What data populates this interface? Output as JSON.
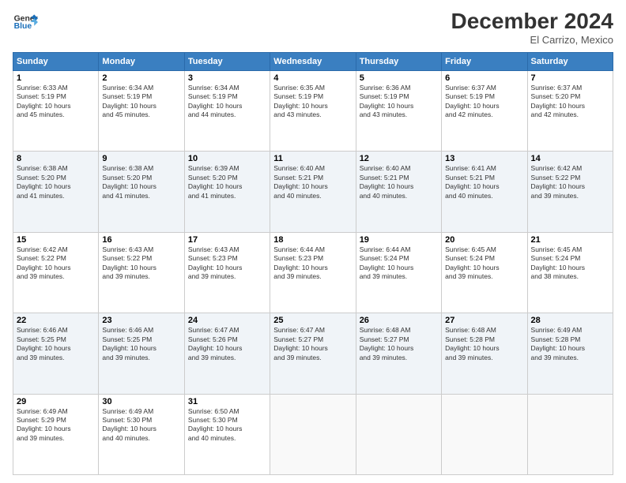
{
  "header": {
    "title": "December 2024",
    "subtitle": "El Carrizo, Mexico"
  },
  "calendar": {
    "days": [
      "Sunday",
      "Monday",
      "Tuesday",
      "Wednesday",
      "Thursday",
      "Friday",
      "Saturday"
    ],
    "weeks": [
      [
        {
          "day": "1",
          "info": "Sunrise: 6:33 AM\nSunset: 5:19 PM\nDaylight: 10 hours\nand 45 minutes."
        },
        {
          "day": "2",
          "info": "Sunrise: 6:34 AM\nSunset: 5:19 PM\nDaylight: 10 hours\nand 45 minutes."
        },
        {
          "day": "3",
          "info": "Sunrise: 6:34 AM\nSunset: 5:19 PM\nDaylight: 10 hours\nand 44 minutes."
        },
        {
          "day": "4",
          "info": "Sunrise: 6:35 AM\nSunset: 5:19 PM\nDaylight: 10 hours\nand 43 minutes."
        },
        {
          "day": "5",
          "info": "Sunrise: 6:36 AM\nSunset: 5:19 PM\nDaylight: 10 hours\nand 43 minutes."
        },
        {
          "day": "6",
          "info": "Sunrise: 6:37 AM\nSunset: 5:19 PM\nDaylight: 10 hours\nand 42 minutes."
        },
        {
          "day": "7",
          "info": "Sunrise: 6:37 AM\nSunset: 5:20 PM\nDaylight: 10 hours\nand 42 minutes."
        }
      ],
      [
        {
          "day": "8",
          "info": "Sunrise: 6:38 AM\nSunset: 5:20 PM\nDaylight: 10 hours\nand 41 minutes."
        },
        {
          "day": "9",
          "info": "Sunrise: 6:38 AM\nSunset: 5:20 PM\nDaylight: 10 hours\nand 41 minutes."
        },
        {
          "day": "10",
          "info": "Sunrise: 6:39 AM\nSunset: 5:20 PM\nDaylight: 10 hours\nand 41 minutes."
        },
        {
          "day": "11",
          "info": "Sunrise: 6:40 AM\nSunset: 5:21 PM\nDaylight: 10 hours\nand 40 minutes."
        },
        {
          "day": "12",
          "info": "Sunrise: 6:40 AM\nSunset: 5:21 PM\nDaylight: 10 hours\nand 40 minutes."
        },
        {
          "day": "13",
          "info": "Sunrise: 6:41 AM\nSunset: 5:21 PM\nDaylight: 10 hours\nand 40 minutes."
        },
        {
          "day": "14",
          "info": "Sunrise: 6:42 AM\nSunset: 5:22 PM\nDaylight: 10 hours\nand 39 minutes."
        }
      ],
      [
        {
          "day": "15",
          "info": "Sunrise: 6:42 AM\nSunset: 5:22 PM\nDaylight: 10 hours\nand 39 minutes."
        },
        {
          "day": "16",
          "info": "Sunrise: 6:43 AM\nSunset: 5:22 PM\nDaylight: 10 hours\nand 39 minutes."
        },
        {
          "day": "17",
          "info": "Sunrise: 6:43 AM\nSunset: 5:23 PM\nDaylight: 10 hours\nand 39 minutes."
        },
        {
          "day": "18",
          "info": "Sunrise: 6:44 AM\nSunset: 5:23 PM\nDaylight: 10 hours\nand 39 minutes."
        },
        {
          "day": "19",
          "info": "Sunrise: 6:44 AM\nSunset: 5:24 PM\nDaylight: 10 hours\nand 39 minutes."
        },
        {
          "day": "20",
          "info": "Sunrise: 6:45 AM\nSunset: 5:24 PM\nDaylight: 10 hours\nand 39 minutes."
        },
        {
          "day": "21",
          "info": "Sunrise: 6:45 AM\nSunset: 5:24 PM\nDaylight: 10 hours\nand 38 minutes."
        }
      ],
      [
        {
          "day": "22",
          "info": "Sunrise: 6:46 AM\nSunset: 5:25 PM\nDaylight: 10 hours\nand 39 minutes."
        },
        {
          "day": "23",
          "info": "Sunrise: 6:46 AM\nSunset: 5:25 PM\nDaylight: 10 hours\nand 39 minutes."
        },
        {
          "day": "24",
          "info": "Sunrise: 6:47 AM\nSunset: 5:26 PM\nDaylight: 10 hours\nand 39 minutes."
        },
        {
          "day": "25",
          "info": "Sunrise: 6:47 AM\nSunset: 5:27 PM\nDaylight: 10 hours\nand 39 minutes."
        },
        {
          "day": "26",
          "info": "Sunrise: 6:48 AM\nSunset: 5:27 PM\nDaylight: 10 hours\nand 39 minutes."
        },
        {
          "day": "27",
          "info": "Sunrise: 6:48 AM\nSunset: 5:28 PM\nDaylight: 10 hours\nand 39 minutes."
        },
        {
          "day": "28",
          "info": "Sunrise: 6:49 AM\nSunset: 5:28 PM\nDaylight: 10 hours\nand 39 minutes."
        }
      ],
      [
        {
          "day": "29",
          "info": "Sunrise: 6:49 AM\nSunset: 5:29 PM\nDaylight: 10 hours\nand 39 minutes."
        },
        {
          "day": "30",
          "info": "Sunrise: 6:49 AM\nSunset: 5:30 PM\nDaylight: 10 hours\nand 40 minutes."
        },
        {
          "day": "31",
          "info": "Sunrise: 6:50 AM\nSunset: 5:30 PM\nDaylight: 10 hours\nand 40 minutes."
        },
        {
          "day": "",
          "info": ""
        },
        {
          "day": "",
          "info": ""
        },
        {
          "day": "",
          "info": ""
        },
        {
          "day": "",
          "info": ""
        }
      ]
    ]
  }
}
